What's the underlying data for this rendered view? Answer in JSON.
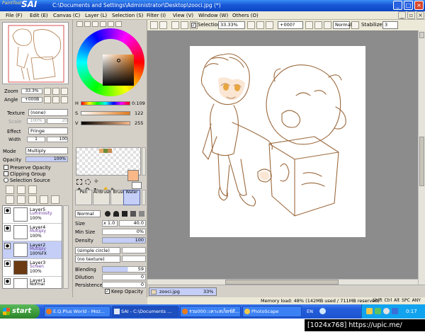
{
  "app": {
    "logo_small": "PaintTool",
    "logo_big": "SAI",
    "title": "C:\\Documents and Settings\\Administrator\\Desktop\\zooci.jpg (*)"
  },
  "menu": [
    "File (F)",
    "Edit (E)",
    "Canvas (C)",
    "Layer (L)",
    "Selection (S)",
    "Filter (I)",
    "View (V)",
    "Window (W)",
    "Others (O)"
  ],
  "toolbar": {
    "selection_label": "Selection",
    "selection_checked": true,
    "zoom": "33.33%",
    "angle": "+000?",
    "mode": "Normal",
    "stabilizer_label": "Stabilizer",
    "stabilizer": "3"
  },
  "navigator": {
    "zoom_label": "Zoom",
    "zoom_value": "33.3%",
    "angle_label": "Angle",
    "angle_value": "+000B"
  },
  "texture": {
    "label": "Texture",
    "value": "(none)",
    "scale_label": "Scale",
    "scale_value": "100%",
    "scale_right": "20"
  },
  "effect": {
    "label": "Effect",
    "value": "Fringe",
    "width_label": "Width",
    "width_value": "1",
    "width_right": "100"
  },
  "layer_props": {
    "mode_label": "Mode",
    "mode_value": "Multiply",
    "opacity_label": "Opacity",
    "opacity_value": "100%",
    "preserve_opacity": "Preserve Opacity",
    "clipping_group": "Clipping Group",
    "selection_source": "Selection Source"
  },
  "layers": [
    {
      "name": "Layer5",
      "mode": "Luminosity",
      "opacity": "100%",
      "selected": false,
      "thumb": "#ffffff"
    },
    {
      "name": "Layer4",
      "mode": "Multiply",
      "opacity": "100%",
      "selected": false,
      "thumb": "#ffffff"
    },
    {
      "name": "Layer2",
      "mode": "Multiply",
      "opacity": "100%FX",
      "selected": true,
      "thumb": "#ffffff"
    },
    {
      "name": "Layer3",
      "mode": "Screen",
      "opacity": "100%",
      "selected": false,
      "thumb": "#6b3a12"
    },
    {
      "name": "Layer1",
      "mode": "Normal",
      "opacity": "100%",
      "selected": false,
      "thumb": "#ffffff"
    }
  ],
  "color": {
    "h_label": "H",
    "h_value": "0:109",
    "s_label": "S",
    "s_value": "122",
    "v_label": "V",
    "v_value": "255",
    "current": "#f8b888",
    "swatches": [
      "#e6a86a",
      "#6c8c3a",
      "#c88a4a"
    ]
  },
  "tools": [
    {
      "label": "Pen",
      "selected": false
    },
    {
      "label": "AirBrush",
      "selected": false
    },
    {
      "label": "Brush",
      "selected": false
    },
    {
      "label": "Water",
      "selected": true
    }
  ],
  "brush": {
    "mode": "Normal",
    "size_label": "Size",
    "size_mult": "x 1.0",
    "size_value": "40.0",
    "min_size_label": "Min Size",
    "min_size_value": "0%",
    "density_label": "Density",
    "density_value": "100",
    "shape": "(simple circle)",
    "texture": "(no texture)",
    "blending_label": "Blending",
    "blending_value": "59",
    "dilution_label": "Dilution",
    "dilution_value": "0",
    "persistence_label": "Persistence",
    "persistence_value": "0",
    "keep_opacity": "Keep Opacity"
  },
  "filetab": {
    "name": "zooci.jpg",
    "zoom": "33%"
  },
  "status": {
    "memory": "Memory load: 48% (142MB used / 711MB reserved)",
    "keys": "Shift Ctrl Alt SPC ANY"
  },
  "taskbar": {
    "start": "start",
    "tasks": [
      {
        "label": "E.Q.Plus World - Moz...",
        "active": false
      },
      {
        "label": "SAI - C:\\Documents ...",
        "active": true
      },
      {
        "label": "รวม000::เคาะสเก็ตช์ดี...",
        "active": false
      },
      {
        "label": "PhotoScape",
        "active": false
      }
    ],
    "lang": "EN",
    "clock": "0:17"
  },
  "caption": "[1024x768] https://upic.me/"
}
